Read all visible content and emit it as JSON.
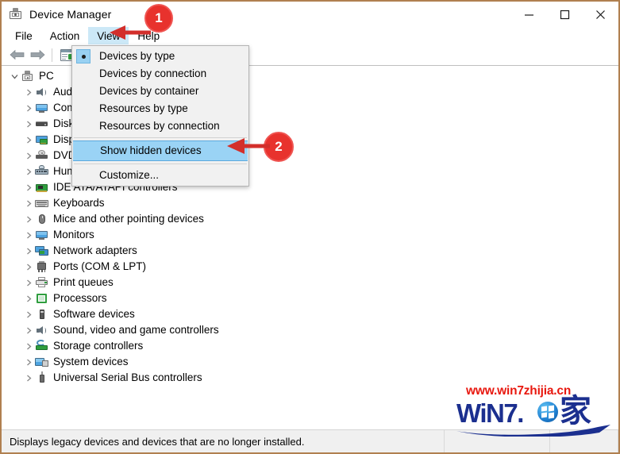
{
  "window": {
    "title": "Device Manager",
    "icon": "device-manager-icon",
    "controls": {
      "minimize": "–",
      "maximize": "□",
      "close": "✕"
    }
  },
  "menubar": {
    "items": [
      {
        "label": "File",
        "active": false
      },
      {
        "label": "Action",
        "active": false
      },
      {
        "label": "View",
        "active": true
      },
      {
        "label": "Help",
        "active": false
      }
    ]
  },
  "toolbar": {
    "back": "back-arrow",
    "forward": "forward-arrow",
    "properties": "properties-icon"
  },
  "view_menu": {
    "items": [
      {
        "label": "Devices by type",
        "radio": true,
        "selected": false,
        "separator_after": false
      },
      {
        "label": "Devices by connection",
        "radio": false,
        "selected": false,
        "separator_after": false
      },
      {
        "label": "Devices by container",
        "radio": false,
        "selected": false,
        "separator_after": false
      },
      {
        "label": "Resources by type",
        "radio": false,
        "selected": false,
        "separator_after": false
      },
      {
        "label": "Resources by connection",
        "radio": false,
        "selected": false,
        "separator_after": true
      },
      {
        "label": "Show hidden devices",
        "radio": false,
        "selected": true,
        "separator_after": true
      },
      {
        "label": "Customize...",
        "radio": false,
        "selected": false,
        "separator_after": false
      }
    ]
  },
  "tree": {
    "root": {
      "label": "PC",
      "icon": "pc-icon",
      "expanded": true
    },
    "items": [
      {
        "label": "Audio inputs and outputs",
        "icon": "speaker-icon"
      },
      {
        "label": "Computer",
        "icon": "monitor-icon"
      },
      {
        "label": "Disk drives",
        "icon": "disk-icon"
      },
      {
        "label": "Display adapters",
        "icon": "display-adapter-icon"
      },
      {
        "label": "DVD/CD-ROM drives",
        "icon": "dvd-icon"
      },
      {
        "label": "Human Interface Devices",
        "icon": "hid-icon"
      },
      {
        "label": "IDE ATA/ATAPI controllers",
        "icon": "ide-icon"
      },
      {
        "label": "Keyboards",
        "icon": "keyboard-icon"
      },
      {
        "label": "Mice and other pointing devices",
        "icon": "mouse-icon"
      },
      {
        "label": "Monitors",
        "icon": "monitor-icon"
      },
      {
        "label": "Network adapters",
        "icon": "network-icon"
      },
      {
        "label": "Ports (COM & LPT)",
        "icon": "port-icon"
      },
      {
        "label": "Print queues",
        "icon": "printer-icon"
      },
      {
        "label": "Processors",
        "icon": "processor-icon"
      },
      {
        "label": "Software devices",
        "icon": "software-device-icon"
      },
      {
        "label": "Sound, video and game controllers",
        "icon": "speaker-icon"
      },
      {
        "label": "Storage controllers",
        "icon": "storage-icon"
      },
      {
        "label": "System devices",
        "icon": "system-device-icon"
      },
      {
        "label": "Universal Serial Bus controllers",
        "icon": "usb-icon"
      }
    ]
  },
  "statusbar": {
    "message": "Displays legacy devices and devices that are no longer installed."
  },
  "annotations": [
    {
      "number": "1",
      "target": "view-menu"
    },
    {
      "number": "2",
      "target": "show-hidden-devices"
    }
  ],
  "watermark": {
    "url": "www.win7zhijia.cn",
    "logo_text": "WiN7.",
    "logo_cjk": "家"
  },
  "colors": {
    "accent_blue": "#9ad3f5",
    "menu_active": "#cce8f7",
    "annotation_red": "#e8322d",
    "watermark_red": "#e8180f",
    "watermark_blue": "#1b2f8f",
    "window_border": "#b08050"
  }
}
